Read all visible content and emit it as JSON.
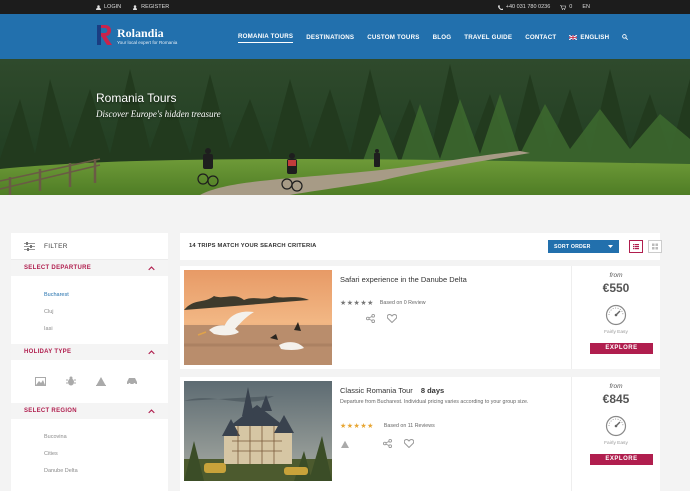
{
  "topbar": {
    "login": "LOGIN",
    "register": "REGISTER",
    "phone": "+40 031 780 0236",
    "cart_count": "0",
    "lang": "EN"
  },
  "brand": {
    "name": "Rolandia",
    "tagline": "Your local expert for Romania",
    "primary_color": "#2270ad",
    "accent_color": "#b01e4e"
  },
  "nav": {
    "romania_tours": "ROMANIA TOURS",
    "destinations": "DESTINATIONS",
    "custom_tours": "CUSTOM TOURS",
    "blog": "BLOG",
    "travel_guide": "TRAVEL GUIDE",
    "contact": "CONTACT",
    "english": "ENGLISH"
  },
  "hero": {
    "title": "Romania Tours",
    "subtitle": "Discover Europe's hidden treasure"
  },
  "filter": {
    "title": "FILTER",
    "departure": {
      "title": "SELECT DEPARTURE",
      "options": [
        "Bucharest",
        "Cluj",
        "Iasi"
      ]
    },
    "holiday_type": {
      "title": "HOLIDAY TYPE",
      "icons": [
        "image-icon",
        "bug-icon",
        "mountain-icon",
        "car-icon"
      ]
    },
    "region": {
      "title": "SELECT REGION",
      "options": [
        "Bucovina",
        "Cities",
        "Danube Delta"
      ]
    }
  },
  "results": {
    "count_text": "14 TRIPS MATCH YOUR SEARCH CRITERIA",
    "sort_label": "SORT ORDER"
  },
  "trips": [
    {
      "title": "Safari experience in the Danube Delta",
      "days": "",
      "description": "",
      "stars": "★★★★★",
      "rating": 0,
      "reviews": "Based on 0 Review",
      "from": "from",
      "price": "€550",
      "difficulty": "Fairly Easy",
      "explore": "EXPLORE"
    },
    {
      "title": "Classic Romania Tour",
      "days": "8 days",
      "description": "Departure from Bucharest. Individual pricing varies according to your group size.",
      "stars": "★★★★★",
      "rating": 5,
      "reviews": "Based on 11 Reviews",
      "from": "from",
      "price": "€845",
      "difficulty": "Fairly Easy",
      "explore": "EXPLORE"
    }
  ]
}
